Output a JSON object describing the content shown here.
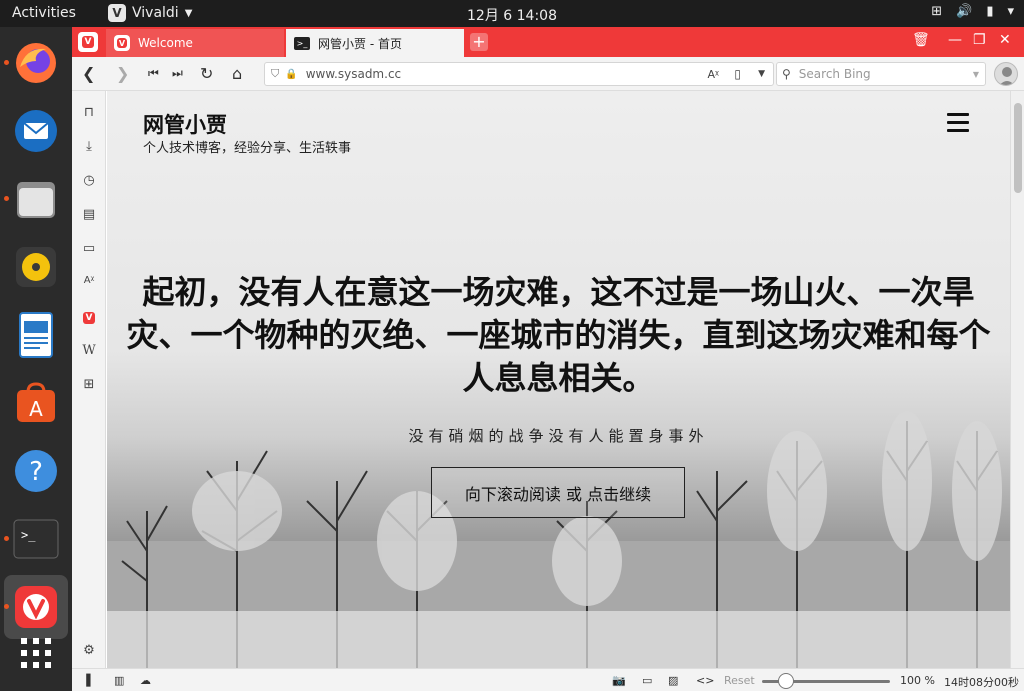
{
  "topbar": {
    "activities": "Activities",
    "app_name": "Vivaldi",
    "clock": "12月 6  14:08"
  },
  "dock": {
    "items": [
      "firefox-icon",
      "thunderbird-icon",
      "files-icon",
      "rhythmbox-icon",
      "writer-icon",
      "software-icon",
      "help-icon",
      "terminal-icon",
      "vivaldi-icon",
      "app-grid-icon"
    ]
  },
  "browser": {
    "tabs": [
      {
        "label": "Welcome"
      },
      {
        "label": "网管小贾 - 首页"
      }
    ],
    "url": "www.sysadm.cc",
    "search_placeholder": "Search Bing"
  },
  "page": {
    "site_title": "网管小贾",
    "site_subtitle": "个人技术博客，经验分享、生活轶事",
    "headline": "起初，没有人在意这一场灾难，这不过是一场山火、一次旱灾、一个物种的灭绝、一座城市的消失，直到这场灾难和每个人息息相关。",
    "subline": "没有硝烟的战争没有人能置身事外",
    "cta": "向下滚动阅读 或 点击继续"
  },
  "statusbar": {
    "reset": "Reset",
    "zoom": "100 %",
    "clock": "14时08分00秒"
  }
}
